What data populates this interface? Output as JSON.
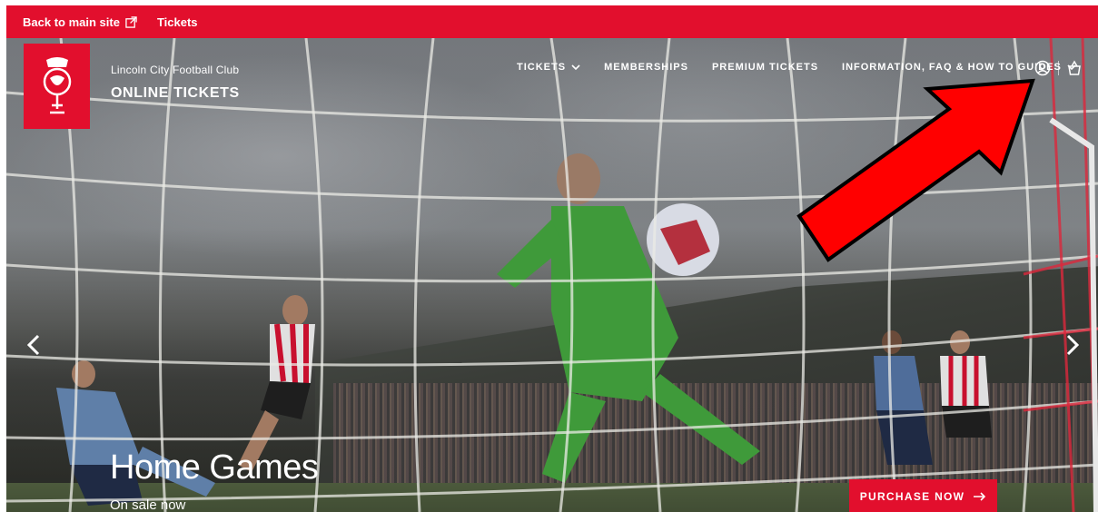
{
  "topbar": {
    "back_label": "Back to main site",
    "tickets_label": "Tickets"
  },
  "brand": {
    "club_name": "Lincoln City Football Club",
    "subtitle": "ONLINE TICKETS"
  },
  "nav": {
    "items": [
      {
        "label": "TICKETS",
        "has_dropdown": true
      },
      {
        "label": "MEMBERSHIPS",
        "has_dropdown": false
      },
      {
        "label": "PREMIUM TICKETS",
        "has_dropdown": false
      },
      {
        "label": "INFORMATION, FAQ & HOW TO GUIDES",
        "has_dropdown": true
      }
    ]
  },
  "icons": {
    "account": "user-circle-icon",
    "basket": "basket-icon"
  },
  "hero": {
    "title": "Home Games",
    "subtitle": "On sale now",
    "cta_label": "PURCHASE NOW"
  },
  "colors": {
    "brand_red": "#e20f2d",
    "annotation_red": "#ff0000"
  }
}
